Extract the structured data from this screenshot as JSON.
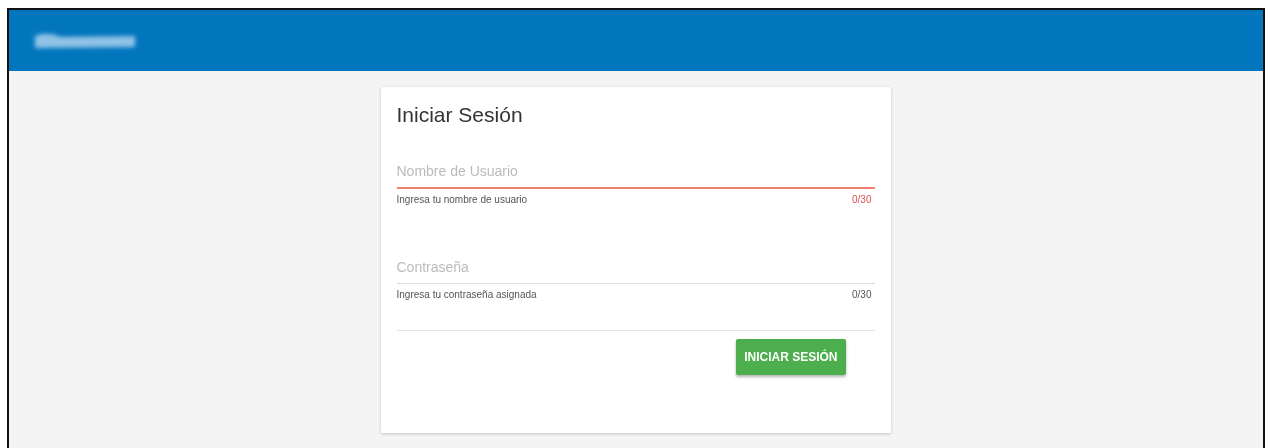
{
  "login_card": {
    "title": "Iniciar Sesión",
    "fields": [
      {
        "placeholder": "Nombre de Usuario",
        "hint": "Ingresa tu nombre de usuario",
        "counter": "0/30",
        "error": true
      },
      {
        "placeholder": "Contraseña",
        "hint": "Ingresa tu contraseña asignada",
        "counter": "0/30",
        "error": false
      }
    ],
    "button": "INICIAR SESIÓN"
  }
}
